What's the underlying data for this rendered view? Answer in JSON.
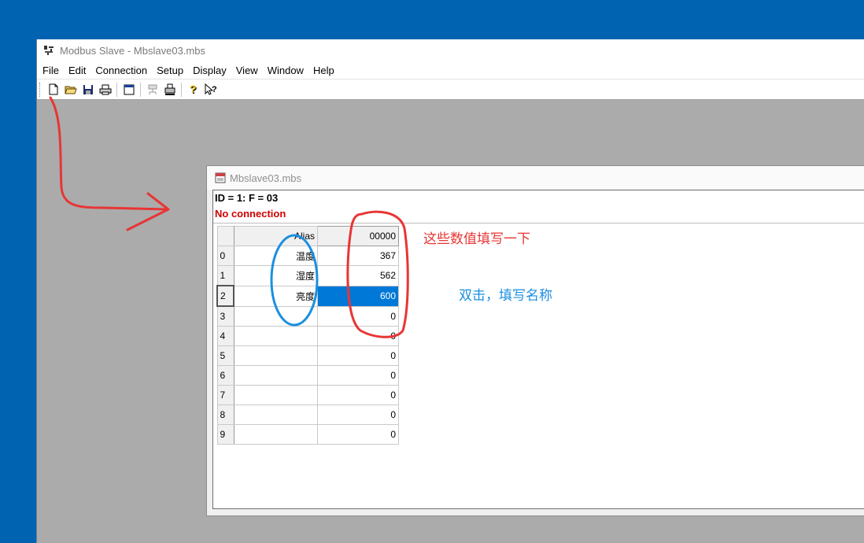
{
  "window": {
    "title": "Modbus Slave - Mbslave03.mbs"
  },
  "menu": [
    "File",
    "Edit",
    "Connection",
    "Setup",
    "Display",
    "View",
    "Window",
    "Help"
  ],
  "toolbar": {
    "buttons": [
      "new-icon",
      "open-folder-icon",
      "save-icon",
      "print-icon",
      "window-icon",
      "connect-icon",
      "printer-setup-icon",
      "help-icon",
      "context-help-icon"
    ]
  },
  "doc": {
    "title": "Mbslave03.mbs",
    "line1": "ID = 1: F = 03",
    "status": "No connection",
    "header": {
      "alias": "Alias",
      "address": "00000"
    },
    "rows": [
      {
        "index": "0",
        "alias": "温度",
        "value": "367"
      },
      {
        "index": "1",
        "alias": "湿度",
        "value": "562"
      },
      {
        "index": "2",
        "alias": "亮度",
        "value": "600"
      },
      {
        "index": "3",
        "alias": "",
        "value": "0"
      },
      {
        "index": "4",
        "alias": "",
        "value": "0"
      },
      {
        "index": "5",
        "alias": "",
        "value": "0"
      },
      {
        "index": "6",
        "alias": "",
        "value": "0"
      },
      {
        "index": "7",
        "alias": "",
        "value": "0"
      },
      {
        "index": "8",
        "alias": "",
        "value": "0"
      },
      {
        "index": "9",
        "alias": "",
        "value": "0"
      }
    ],
    "selected_row": 2
  },
  "annotations": {
    "red_note": "这些数值填写一下",
    "blue_note": "双击，填写名称",
    "red_color": "#e83535",
    "blue_color": "#1a8fe0"
  }
}
